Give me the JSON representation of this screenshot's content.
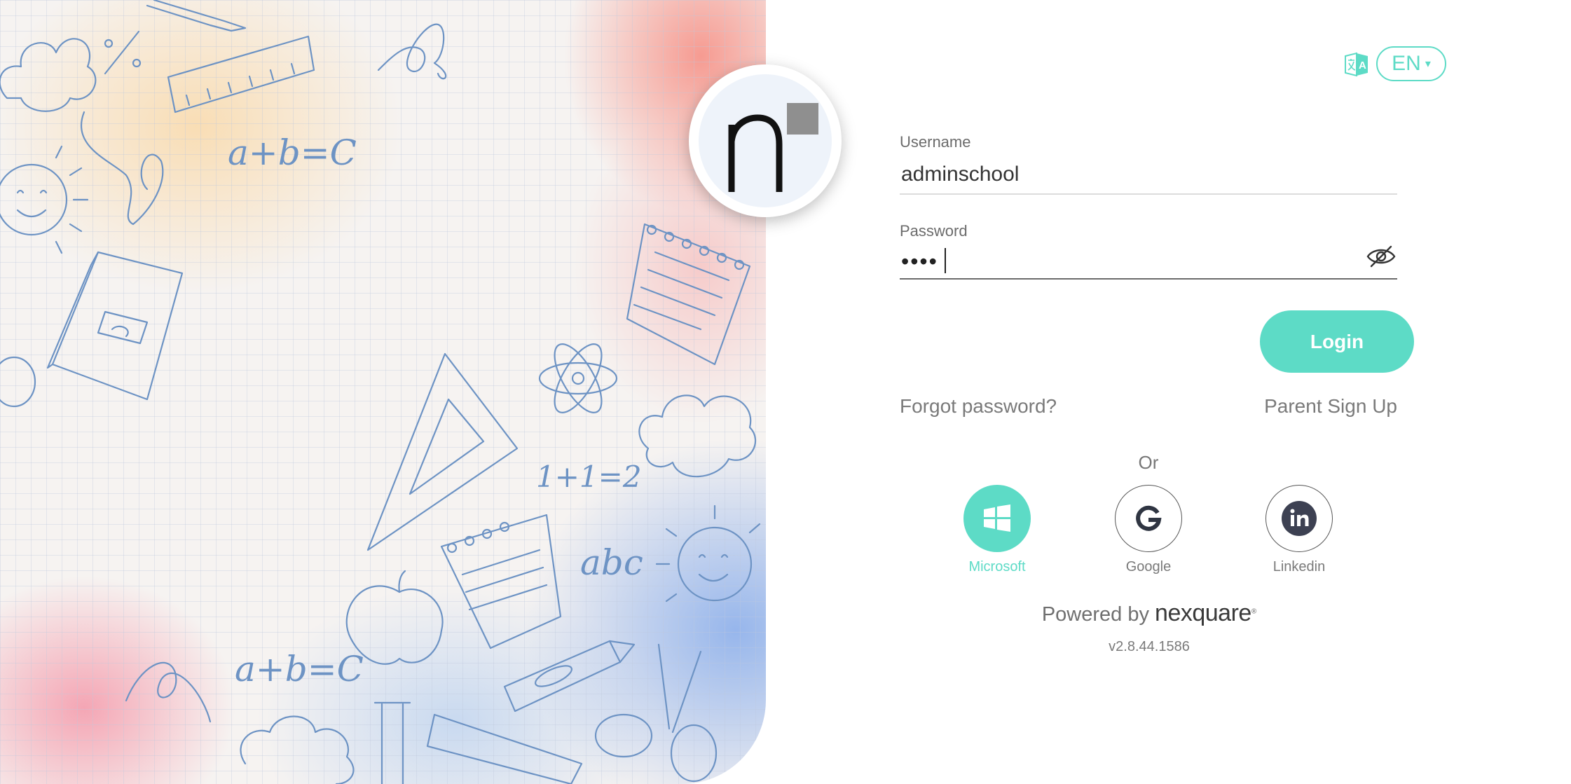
{
  "language": {
    "selected": "EN",
    "caret": "▾"
  },
  "form": {
    "username_label": "Username",
    "username_value": "adminschool",
    "password_label": "Password",
    "password_value": "••••",
    "login_label": "Login",
    "forgot_label": "Forgot password?",
    "signup_label": "Parent Sign Up",
    "or_label": "Or"
  },
  "social": {
    "microsoft_label": "Microsoft",
    "google_label": "Google",
    "linkedin_label": "Linkedin"
  },
  "footer": {
    "powered_by": "Powered by",
    "brand": "nexquare",
    "version": "v2.8.44.1586"
  },
  "illustration": {
    "texts": [
      "a+b=C",
      "1+1=2",
      "abc",
      "a+b=C",
      "%"
    ]
  },
  "icons": {
    "logo": "nexquare-n-logo",
    "translate": "translate-icon",
    "eye": "eye-slash-icon",
    "microsoft": "windows-icon",
    "google": "google-g-icon",
    "linkedin": "linkedin-icon"
  },
  "colors": {
    "accent": "#5ddbc6",
    "doodle": "#6d93c4",
    "text_muted": "#7a7a7a",
    "linkedin_dark": "#3d4152"
  }
}
